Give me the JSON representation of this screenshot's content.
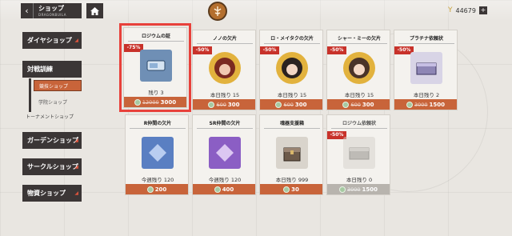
{
  "header": {
    "back_title": "ショップ",
    "back_subtitle": "DRAGONBUILA",
    "currency_value": "44679",
    "currency_plus": "+"
  },
  "sidebar": {
    "items": [
      {
        "label": "ダイヤショップ"
      },
      {
        "label": "対戦訓練"
      },
      {
        "label": "ガーデンショップ"
      },
      {
        "label": "サークルショップ"
      },
      {
        "label": "物資ショップ"
      }
    ],
    "sub_items": [
      {
        "label": "競技ショップ",
        "selected": true
      },
      {
        "label": "学院ショップ",
        "selected": false
      }
    ],
    "tournament_label": "トーナメントショップ"
  },
  "cards": [
    {
      "name": "ロジウムの証",
      "discount": "-75%",
      "remain": "残り 3",
      "old_price": "12000",
      "price": "3000",
      "highlight": true,
      "icon": "rhodium-ticket-icon"
    },
    {
      "name": "ノノの欠片",
      "discount": "-50%",
      "remain": "本日残り 15",
      "old_price": "600",
      "price": "300",
      "icon": "character-portrait-icon"
    },
    {
      "name": "ロ・メイタクの欠片",
      "discount": "-50%",
      "remain": "本日残り 15",
      "old_price": "600",
      "price": "300",
      "icon": "character-portrait-icon"
    },
    {
      "name": "シャー・ミーの欠片",
      "discount": "-50%",
      "remain": "本日残り 15",
      "old_price": "600",
      "price": "300",
      "icon": "character-portrait-icon"
    },
    {
      "name": "プラチナ依頼状",
      "discount": "-50%",
      "remain": "本日残り 2",
      "old_price": "3000",
      "price": "1500",
      "icon": "platinum-crate-icon"
    },
    {
      "name": "R仲間の欠片",
      "discount": "",
      "remain": "今週残り 120",
      "old_price": "",
      "price": "200",
      "icon": "r-shard-icon"
    },
    {
      "name": "SR仲間の欠片",
      "discount": "",
      "remain": "今週残り 120",
      "old_price": "",
      "price": "400",
      "icon": "sr-shard-icon"
    },
    {
      "name": "魂器支援箱",
      "discount": "",
      "remain": "本日残り 999",
      "old_price": "",
      "price": "30",
      "icon": "support-box-icon"
    },
    {
      "name": "ロジウム依頼状",
      "discount": "-50%",
      "remain": "本日残り 0",
      "old_price": "3000",
      "price": "1500",
      "icon": "rhodium-request-icon",
      "soldout": true
    }
  ],
  "colors": {
    "accent": "#c8643a",
    "discount": "#c8322a",
    "highlight": "#e8413b",
    "dark": "#3b3636"
  }
}
